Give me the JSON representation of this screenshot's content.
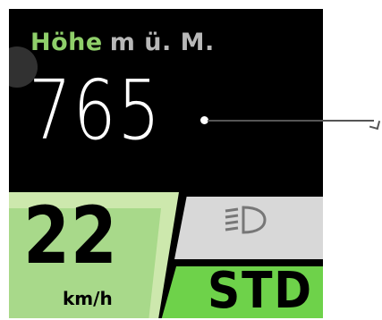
{
  "header": {
    "label": "Höhe",
    "unit": "m ü. M."
  },
  "altitude": {
    "value": "765"
  },
  "speed": {
    "value": "22",
    "unit": "km/h"
  },
  "light": {
    "icon": "headlight-icon"
  },
  "mode": {
    "value": "STD"
  },
  "colors": {
    "label_green": "#8fcf6a",
    "speed_panel_green": "#a8d98a",
    "mode_green": "#6ed24a",
    "light_panel_gray": "#d8d8d8"
  }
}
